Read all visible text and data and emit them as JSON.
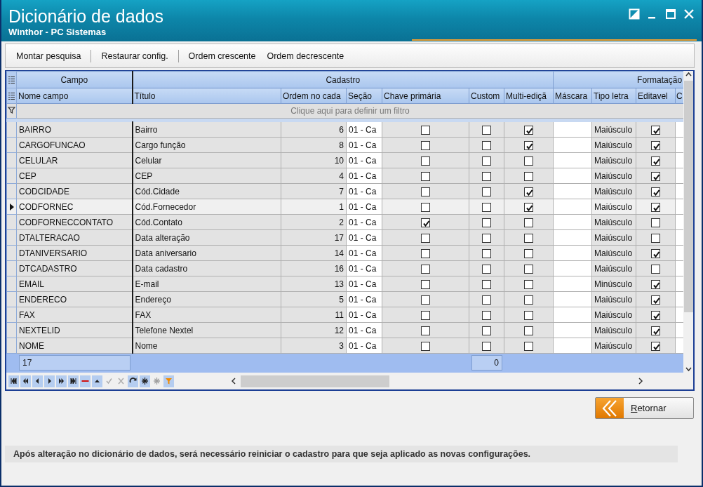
{
  "window": {
    "title": "Dicionário de dados",
    "subtitle": "Winthor - PC Sistemas",
    "controls": [
      {
        "kind": "dock"
      },
      {
        "kind": "minimize"
      },
      {
        "kind": "maximize"
      },
      {
        "kind": "close"
      }
    ]
  },
  "toolbar": [
    "Montar pesquisa",
    "Restaurar config.",
    "Ordem crescente",
    "Ordem decrescente"
  ],
  "grid": {
    "bands": [
      {
        "label": "Campo",
        "columns": [
          {
            "label": "Nome campo",
            "kind": "text"
          }
        ]
      },
      {
        "label": "Cadastro",
        "columns": [
          {
            "label": "Título",
            "kind": "text"
          },
          {
            "label": "Ordem no cada",
            "kind": "number"
          },
          {
            "label": "Seção",
            "kind": "field"
          },
          {
            "label": "Chave primária",
            "kind": "check"
          },
          {
            "label": "Custom",
            "kind": "check"
          },
          {
            "label": "Multi-ediçã",
            "kind": "check"
          }
        ]
      },
      {
        "label": "Formatação",
        "columns": [
          {
            "label": "Máscara",
            "kind": "blank"
          },
          {
            "label": "Tipo letra",
            "kind": "text"
          },
          {
            "label": "Editavel",
            "kind": "check"
          },
          {
            "label": "C",
            "kind": "blank"
          }
        ]
      }
    ],
    "filter_hint": "Clique aqui para definir um filtro",
    "rows": [
      {
        "selected": false,
        "cells": [
          "BAIRRO",
          "Bairro",
          "6",
          "01 - Ca",
          false,
          false,
          true,
          "Maiúsculo",
          true
        ]
      },
      {
        "selected": false,
        "cells": [
          "CARGOFUNCAO",
          "Cargo função",
          "8",
          "01 - Ca",
          false,
          false,
          true,
          "Maiúsculo",
          true
        ]
      },
      {
        "selected": false,
        "cells": [
          "CELULAR",
          "Celular",
          "10",
          "01 - Ca",
          false,
          false,
          false,
          "Maiúsculo",
          true
        ]
      },
      {
        "selected": false,
        "cells": [
          "CEP",
          "CEP",
          "4",
          "01 - Ca",
          false,
          false,
          false,
          "Maiúsculo",
          true
        ]
      },
      {
        "selected": false,
        "cells": [
          "CODCIDADE",
          "Cód.Cidade",
          "7",
          "01 - Ca",
          false,
          false,
          true,
          "Maiúsculo",
          true
        ]
      },
      {
        "selected": true,
        "cells": [
          "CODFORNEC",
          "Cód.Fornecedor",
          "1",
          "01 - Ca",
          false,
          false,
          true,
          "Maiúsculo",
          true
        ]
      },
      {
        "selected": false,
        "cells": [
          "CODFORNECCONTATO",
          "Cód.Contato",
          "2",
          "01 - Ca",
          true,
          false,
          false,
          "Maiúsculo",
          false
        ]
      },
      {
        "selected": false,
        "cells": [
          "DTALTERACAO",
          "Data alteração",
          "17",
          "01 - Ca",
          false,
          false,
          false,
          "Maiúsculo",
          false
        ]
      },
      {
        "selected": false,
        "cells": [
          "DTANIVERSARIO",
          "Data aniversario",
          "14",
          "01 - Ca",
          false,
          false,
          false,
          "Maiúsculo",
          true
        ]
      },
      {
        "selected": false,
        "cells": [
          "DTCADASTRO",
          "Data cadastro",
          "16",
          "01 - Ca",
          false,
          false,
          false,
          "Maiúsculo",
          false
        ]
      },
      {
        "selected": false,
        "cells": [
          "EMAIL",
          "E-mail",
          "13",
          "01 - Ca",
          false,
          false,
          false,
          "Minúsculo",
          true
        ]
      },
      {
        "selected": false,
        "cells": [
          "ENDERECO",
          "Endereço",
          "5",
          "01 - Ca",
          false,
          false,
          false,
          "Maiúsculo",
          true
        ]
      },
      {
        "selected": false,
        "cells": [
          "FAX",
          "FAX",
          "11",
          "01 - Ca",
          false,
          false,
          false,
          "Maiúsculo",
          true
        ]
      },
      {
        "selected": false,
        "cells": [
          "NEXTELID",
          "Telefone Nextel",
          "12",
          "01 - Ca",
          false,
          false,
          false,
          "Maiúsculo",
          true
        ]
      },
      {
        "selected": false,
        "cells": [
          "NOME",
          "Nome",
          "3",
          "01 - Ca",
          false,
          false,
          false,
          "Maiúsculo",
          true
        ]
      }
    ],
    "footer": {
      "count": "17",
      "custom_total": "0"
    },
    "navigator": [
      {
        "kind": "first",
        "disabled": false
      },
      {
        "kind": "prior-page",
        "disabled": false
      },
      {
        "kind": "prior",
        "disabled": false
      },
      {
        "kind": "next",
        "disabled": false
      },
      {
        "kind": "next-page",
        "disabled": false
      },
      {
        "kind": "last",
        "disabled": false
      },
      {
        "kind": "delete",
        "disabled": false
      },
      {
        "kind": "edit",
        "disabled": false
      },
      {
        "kind": "post",
        "disabled": true
      },
      {
        "kind": "cancel",
        "disabled": true
      },
      {
        "kind": "refresh",
        "disabled": false
      },
      {
        "kind": "bookmark",
        "disabled": false
      },
      {
        "kind": "goto-bookmark",
        "disabled": true
      },
      {
        "kind": "filter",
        "disabled": false
      }
    ]
  },
  "return_button": {
    "label": "Retornar"
  },
  "message": "Após alteração no dicionário de dados, será necessário reiniciar o cadastro para que seja aplicado as novas configurações."
}
